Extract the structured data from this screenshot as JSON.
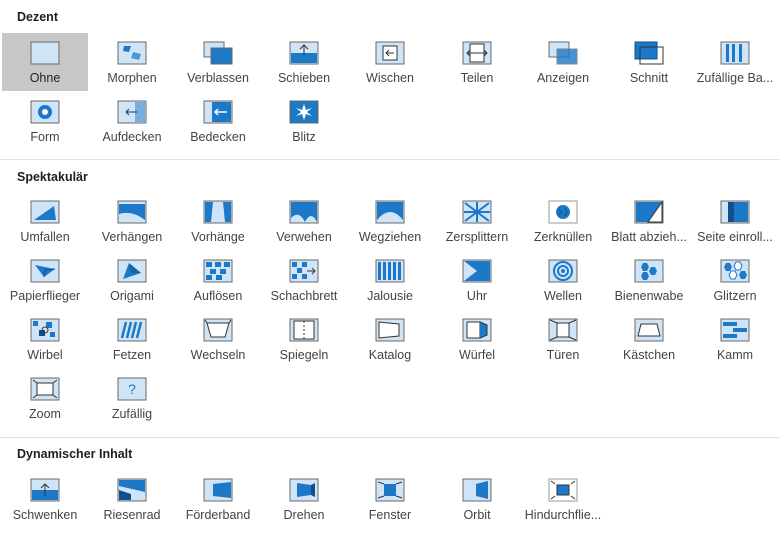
{
  "accent": "#1e78c8",
  "sections": [
    {
      "title": "Dezent",
      "items": [
        {
          "label": "Ohne",
          "icon": "none-transition-icon",
          "selected": true
        },
        {
          "label": "Morphen",
          "icon": "morph-transition-icon"
        },
        {
          "label": "Verblassen",
          "icon": "fade-transition-icon"
        },
        {
          "label": "Schieben",
          "icon": "push-transition-icon"
        },
        {
          "label": "Wischen",
          "icon": "wipe-transition-icon"
        },
        {
          "label": "Teilen",
          "icon": "split-transition-icon"
        },
        {
          "label": "Anzeigen",
          "icon": "reveal-transition-icon"
        },
        {
          "label": "Schnitt",
          "icon": "cut-transition-icon"
        },
        {
          "label": "Zufällige Ba...",
          "icon": "random-bars-transition-icon"
        },
        {
          "label": "Form",
          "icon": "shape-transition-icon"
        },
        {
          "label": "Aufdecken",
          "icon": "uncover-transition-icon"
        },
        {
          "label": "Bedecken",
          "icon": "cover-transition-icon"
        },
        {
          "label": "Blitz",
          "icon": "flash-transition-icon"
        }
      ]
    },
    {
      "title": "Spektakulär",
      "items": [
        {
          "label": "Umfallen",
          "icon": "fall-over-transition-icon"
        },
        {
          "label": "Verhängen",
          "icon": "drape-transition-icon"
        },
        {
          "label": "Vorhänge",
          "icon": "curtains-transition-icon"
        },
        {
          "label": "Verwehen",
          "icon": "wind-transition-icon"
        },
        {
          "label": "Wegziehen",
          "icon": "prestige-transition-icon"
        },
        {
          "label": "Zersplittern",
          "icon": "fracture-transition-icon"
        },
        {
          "label": "Zerknüllen",
          "icon": "crush-transition-icon"
        },
        {
          "label": "Blatt abzieh...",
          "icon": "peel-off-transition-icon"
        },
        {
          "label": "Seite einroll...",
          "icon": "page-curl-transition-icon"
        },
        {
          "label": "Papierflieger",
          "icon": "airplane-transition-icon"
        },
        {
          "label": "Origami",
          "icon": "origami-transition-icon"
        },
        {
          "label": "Auflösen",
          "icon": "dissolve-transition-icon"
        },
        {
          "label": "Schachbrett",
          "icon": "checkerboard-transition-icon"
        },
        {
          "label": "Jalousie",
          "icon": "blinds-transition-icon"
        },
        {
          "label": "Uhr",
          "icon": "clock-transition-icon"
        },
        {
          "label": "Wellen",
          "icon": "ripple-transition-icon"
        },
        {
          "label": "Bienenwabe",
          "icon": "honeycomb-transition-icon"
        },
        {
          "label": "Glitzern",
          "icon": "glitter-transition-icon"
        },
        {
          "label": "Wirbel",
          "icon": "vortex-transition-icon"
        },
        {
          "label": "Fetzen",
          "icon": "shred-transition-icon"
        },
        {
          "label": "Wechseln",
          "icon": "switch-transition-icon"
        },
        {
          "label": "Spiegeln",
          "icon": "flip-transition-icon"
        },
        {
          "label": "Katalog",
          "icon": "gallery-transition-icon"
        },
        {
          "label": "Würfel",
          "icon": "cube-transition-icon"
        },
        {
          "label": "Türen",
          "icon": "doors-transition-icon"
        },
        {
          "label": "Kästchen",
          "icon": "box-transition-icon"
        },
        {
          "label": "Kamm",
          "icon": "comb-transition-icon"
        },
        {
          "label": "Zoom",
          "icon": "zoom-transition-icon"
        },
        {
          "label": "Zufällig",
          "icon": "random-transition-icon"
        }
      ]
    },
    {
      "title": "Dynamischer Inhalt",
      "items": [
        {
          "label": "Schwenken",
          "icon": "pan-transition-icon"
        },
        {
          "label": "Riesenrad",
          "icon": "ferris-wheel-transition-icon"
        },
        {
          "label": "Förderband",
          "icon": "conveyor-transition-icon"
        },
        {
          "label": "Drehen",
          "icon": "rotate-transition-icon"
        },
        {
          "label": "Fenster",
          "icon": "window-transition-icon"
        },
        {
          "label": "Orbit",
          "icon": "orbit-transition-icon"
        },
        {
          "label": "Hindurchflie...",
          "icon": "fly-through-transition-icon"
        }
      ]
    }
  ]
}
